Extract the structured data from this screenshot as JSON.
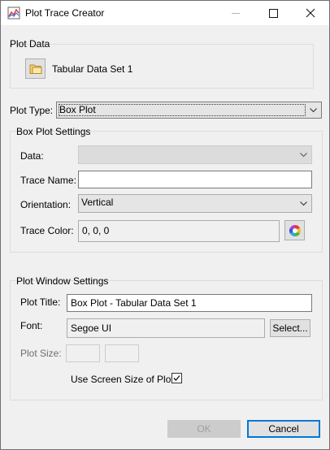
{
  "window": {
    "title": "Plot Trace Creator"
  },
  "plot_data": {
    "group_label": "Plot Data",
    "dataset_label": "Tabular Data Set 1",
    "icon": "folder-icon"
  },
  "plot_type": {
    "label": "Plot Type:",
    "value": "Box Plot"
  },
  "box_plot_settings": {
    "group_label": "Box Plot Settings",
    "data_label": "Data:",
    "data_value": "",
    "trace_name_label": "Trace Name:",
    "trace_name_value": "",
    "orientation_label": "Orientation:",
    "orientation_value": "Vertical",
    "trace_color_label": "Trace Color:",
    "trace_color_value": "0, 0, 0",
    "color_picker_icon": "color-wheel-icon"
  },
  "plot_window_settings": {
    "group_label": "Plot Window Settings",
    "plot_title_label": "Plot Title:",
    "plot_title_value": "Box Plot - Tabular Data Set 1",
    "font_label": "Font:",
    "font_value": "Segoe UI",
    "select_button": "Select...",
    "plot_size_label": "Plot Size:",
    "plot_size_width": "",
    "plot_size_height": "",
    "use_screen_size_label": "Use Screen Size of Plot:",
    "use_screen_size_checked": true
  },
  "footer": {
    "ok_label": "OK",
    "cancel_label": "Cancel"
  },
  "colors": {
    "accent": "#0078d7",
    "window_bg": "#f0f0f0"
  }
}
